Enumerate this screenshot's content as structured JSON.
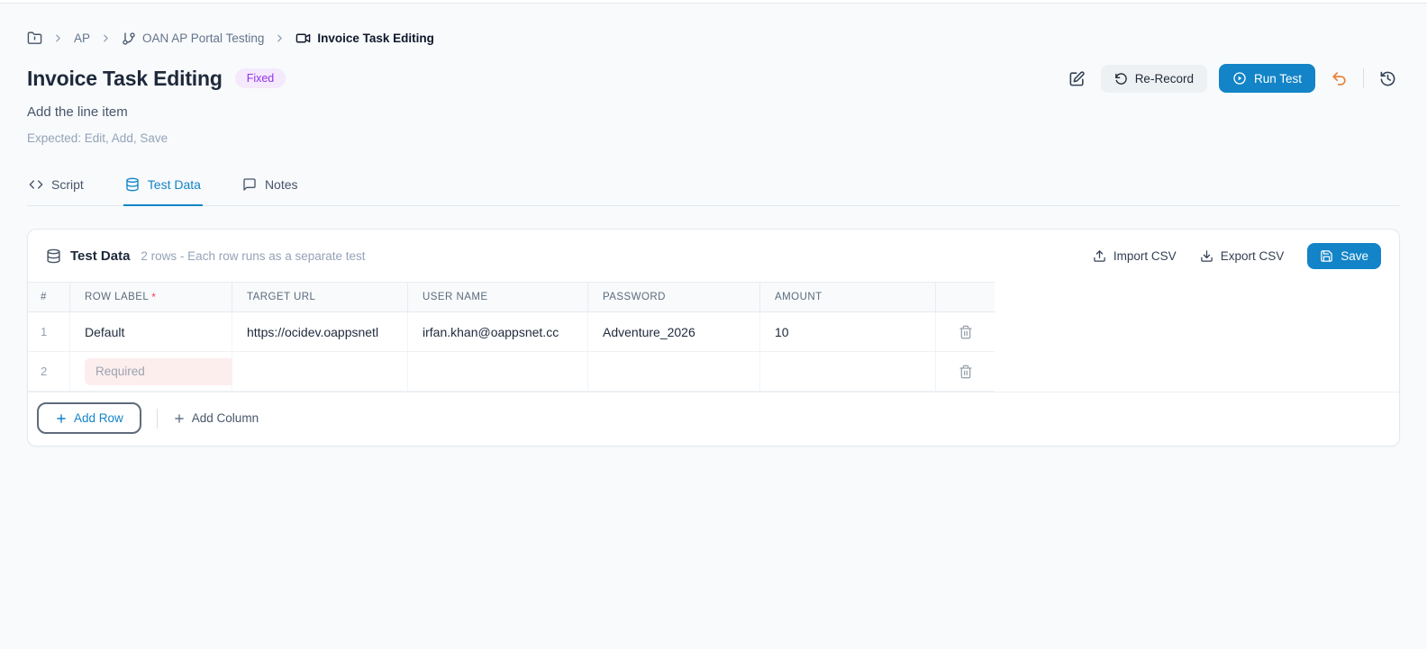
{
  "breadcrumb": {
    "items": [
      {
        "label": "AP"
      },
      {
        "label": "OAN AP Portal Testing"
      },
      {
        "label": "Invoice Task Editing"
      }
    ]
  },
  "header": {
    "title": "Invoice Task Editing",
    "badge": "Fixed",
    "subtitle": "Add the line item",
    "expected": "Expected: Edit, Add, Save"
  },
  "toolbar": {
    "rerecord_label": "Re-Record",
    "run_test_label": "Run Test"
  },
  "tabs": [
    {
      "label": "Script",
      "icon": "code-icon",
      "active": false
    },
    {
      "label": "Test Data",
      "icon": "database-icon",
      "active": true
    },
    {
      "label": "Notes",
      "icon": "chat-icon",
      "active": false
    }
  ],
  "test_data_card": {
    "title": "Test Data",
    "subtitle": "2 rows - Each row runs as a separate test",
    "import_label": "Import CSV",
    "export_label": "Export CSV",
    "save_label": "Save",
    "table": {
      "headers": [
        "#",
        "ROW LABEL",
        "TARGET URL",
        "USER NAME",
        "PASSWORD",
        "AMOUNT"
      ],
      "required_marker": "*",
      "rows": [
        {
          "num": "1",
          "row_label": "Default",
          "target_url": "https://ocidev.oappsnetl",
          "user_name": "irfan.khan@oappsnet.cc",
          "password": "Adventure_2026",
          "amount": "10"
        },
        {
          "num": "2",
          "row_label": "",
          "row_label_placeholder": "Required",
          "target_url": "",
          "user_name": "",
          "password": "",
          "amount": ""
        }
      ]
    },
    "add_row_label": "Add Row",
    "add_column_label": "Add Column"
  },
  "colors": {
    "primary_blue": "#1284c7",
    "badge_purple": "#9333ea",
    "badge_bg": "#f5e9fd",
    "undo_orange": "#e8823b",
    "required_bg": "#fdeeee"
  }
}
